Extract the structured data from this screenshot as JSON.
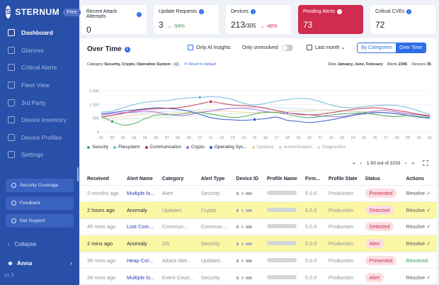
{
  "brand": {
    "name": "STERNUM",
    "badge": "Free",
    "logo_letter": "S"
  },
  "nav": [
    {
      "label": "Dashboard",
      "icon": "dashboard-icon",
      "active": true
    },
    {
      "label": "Glances",
      "icon": "chart-icon"
    },
    {
      "label": "Critical Alerts",
      "icon": "shield-icon"
    },
    {
      "label": "Fleet View",
      "icon": "grid-icon"
    },
    {
      "label": "3rd Party",
      "icon": "cube-icon"
    },
    {
      "label": "Device Inventory",
      "icon": "checklist-icon"
    },
    {
      "label": "Device Profiles",
      "icon": "list-icon"
    },
    {
      "label": "Settings",
      "icon": "gear-icon"
    }
  ],
  "side_buttons": {
    "coverage": "Security Coverage",
    "feedback": "Feedback",
    "support": "Get Support"
  },
  "collapse_label": "Collapse",
  "user": {
    "name": "Anna"
  },
  "version": "v1.3",
  "kpis": {
    "attacks": {
      "label": "Recent Attack Attempts",
      "value": "0"
    },
    "updates": {
      "label": "Update Requests",
      "value": "3",
      "delta": "-94%"
    },
    "devices": {
      "label": "Devices",
      "value": "213",
      "total": "/305",
      "delta": "-48%"
    },
    "pending": {
      "label": "Pending Alerts",
      "value": "73"
    },
    "cves": {
      "label": "Critical CVEs",
      "value": "72"
    }
  },
  "colors": {
    "sidebar": "#2850a8",
    "accent": "#2d6ee8",
    "alert_red": "#cf2c4f",
    "highlight": "#fbf7a4"
  },
  "over_time": {
    "title": "Over Time",
    "only_ai": "Only AI Insights",
    "only_unresolved": "Only unresolved",
    "range": "Last month",
    "seg_categories": "By Categories",
    "seg_overtime": "Over Time",
    "filter_prefix": "Category",
    "filter_value": "Security, Crypto, Operation System",
    "filter_more": "+2",
    "reset": "Reset to default",
    "date_prefix": "Date",
    "date_value": "January, June, February",
    "alerts_prefix": "Alerts",
    "alerts_value": "2345",
    "devices_prefix": "Devices",
    "devices_value": "35"
  },
  "chart_data": {
    "type": "line",
    "x": [
      "01",
      "02",
      "03",
      "04",
      "05",
      "06",
      "07",
      "08",
      "09",
      "10",
      "11",
      "12",
      "13",
      "14",
      "15",
      "16",
      "17",
      "18",
      "19",
      "20",
      "21",
      "22",
      "23",
      "24",
      "25",
      "26",
      "27",
      "28",
      "29",
      "30",
      "31"
    ],
    "y_ticks": [
      "1,500",
      "1,000",
      "500",
      "0"
    ],
    "ylim": [
      0,
      1500
    ],
    "series": [
      {
        "name": "Security",
        "color": "#4aa860",
        "values": [
          560,
          380,
          250,
          300,
          480,
          610,
          620,
          640,
          690,
          700,
          650,
          580,
          530,
          560,
          650,
          710,
          700,
          640,
          560,
          520,
          560,
          620,
          650,
          680,
          690,
          640,
          580,
          560,
          600,
          560,
          520
        ]
      },
      {
        "name": "Filesystem",
        "color": "#6cb7d8",
        "values": [
          720,
          760,
          880,
          1000,
          1080,
          1120,
          1140,
          1200,
          1240,
          1260,
          1280,
          1260,
          1180,
          1040,
          980,
          1040,
          1120,
          1180,
          1220,
          1200,
          1100,
          980,
          900,
          880,
          920,
          960,
          980,
          960,
          880,
          760,
          640
        ]
      },
      {
        "name": "Communication",
        "color": "#c03048",
        "values": [
          540,
          600,
          680,
          760,
          820,
          840,
          860,
          880,
          940,
          1020,
          1100,
          1040,
          980,
          960,
          920,
          860,
          780,
          700,
          640,
          620,
          640,
          700,
          760,
          820,
          860,
          880,
          840,
          780,
          720,
          640,
          580
        ]
      },
      {
        "name": "Crypto",
        "color": "#a565d9",
        "values": [
          620,
          660,
          700,
          720,
          760,
          720,
          640,
          600,
          620,
          700,
          760,
          820,
          860,
          860,
          820,
          740,
          700,
          680,
          660,
          620,
          580,
          560,
          560,
          620,
          700,
          760,
          780,
          720,
          660,
          620,
          560
        ]
      },
      {
        "name": "Operating Sys...",
        "color": "#2d53c9",
        "values": [
          660,
          700,
          760,
          800,
          840,
          880,
          860,
          820,
          760,
          640,
          520,
          460,
          440,
          420,
          450,
          480,
          540,
          420,
          380,
          340,
          380,
          440,
          520,
          600,
          660,
          700,
          700,
          660,
          600,
          540,
          500
        ]
      },
      {
        "name": "Updates",
        "color": "#f0c99a",
        "values": [
          480,
          520,
          560,
          600,
          640,
          660,
          680,
          700,
          720,
          740,
          760,
          760,
          740,
          720,
          700,
          700,
          720,
          740,
          760,
          780,
          800,
          800,
          780,
          760,
          740,
          720,
          700,
          680,
          660,
          640,
          620
        ]
      },
      {
        "name": "Authentication",
        "color": "#b7d8ef",
        "values": [
          580,
          600,
          640,
          680,
          700,
          720,
          740,
          760,
          780,
          800,
          820,
          840,
          860,
          880,
          900,
          900,
          880,
          860,
          840,
          820,
          800,
          780,
          760,
          740,
          720,
          700,
          680,
          660,
          640,
          620,
          600
        ]
      },
      {
        "name": "Diagnostics",
        "color": "#cfe8c8",
        "values": [
          420,
          440,
          460,
          480,
          500,
          520,
          540,
          560,
          580,
          600,
          620,
          640,
          660,
          680,
          700,
          720,
          740,
          760,
          760,
          740,
          720,
          700,
          680,
          660,
          640,
          620,
          600,
          580,
          560,
          540,
          520
        ]
      }
    ],
    "markers": [
      {
        "series": 0,
        "index": 1
      },
      {
        "series": 1,
        "index": 9
      },
      {
        "series": 2,
        "index": 10
      },
      {
        "series": 4,
        "index": 14
      },
      {
        "series": 3,
        "index": 17
      }
    ]
  },
  "table": {
    "pager": {
      "range": "1-50 out of 3233"
    },
    "headers": [
      "Received",
      "Alert Name",
      "Category",
      "Alert Type",
      "Device ID",
      "Profile Name",
      "Firm...",
      "Profile State",
      "Status",
      "Actions"
    ],
    "rows": [
      {
        "received": "3 months ago",
        "name": "Multiple lo...",
        "category": "Alert",
        "type": "Security",
        "firm": "5.0.0",
        "state": "Production",
        "status": "Prevented",
        "action": "Resolve",
        "hl": false
      },
      {
        "received": "2 hours ago",
        "name": "Anomaly",
        "category": "Updates",
        "type": "Crypto",
        "firm": "5.0.0",
        "state": "Production",
        "status": "Detected",
        "action": "Resolve",
        "hl": true
      },
      {
        "received": "45 mins ago",
        "name": "Lost Com...",
        "category": "Commun...",
        "type": "Commun...",
        "firm": "5.0.0",
        "state": "Production",
        "status": "Detected",
        "action": "Resolve",
        "hl": false
      },
      {
        "received": "2 mins ago",
        "name": "Anomaly",
        "category": "OS",
        "type": "Security",
        "firm": "5.0.0",
        "state": "Production",
        "status": "Alert",
        "action": "Resolve",
        "hl": true
      },
      {
        "received": "30 mins ago",
        "name": "Heap Cor...",
        "category": "Attack Atte...",
        "type": "Updates",
        "firm": "5.0.0",
        "state": "Production",
        "status": "Prevented",
        "action": "Resolved",
        "hl": false
      },
      {
        "received": "34 mins ago",
        "name": "Multiple lo...",
        "category": "Event Coun...",
        "type": "Security",
        "firm": "5.0.0",
        "state": "Production",
        "status": "Alert",
        "action": "Resolve",
        "hl": false
      }
    ]
  }
}
